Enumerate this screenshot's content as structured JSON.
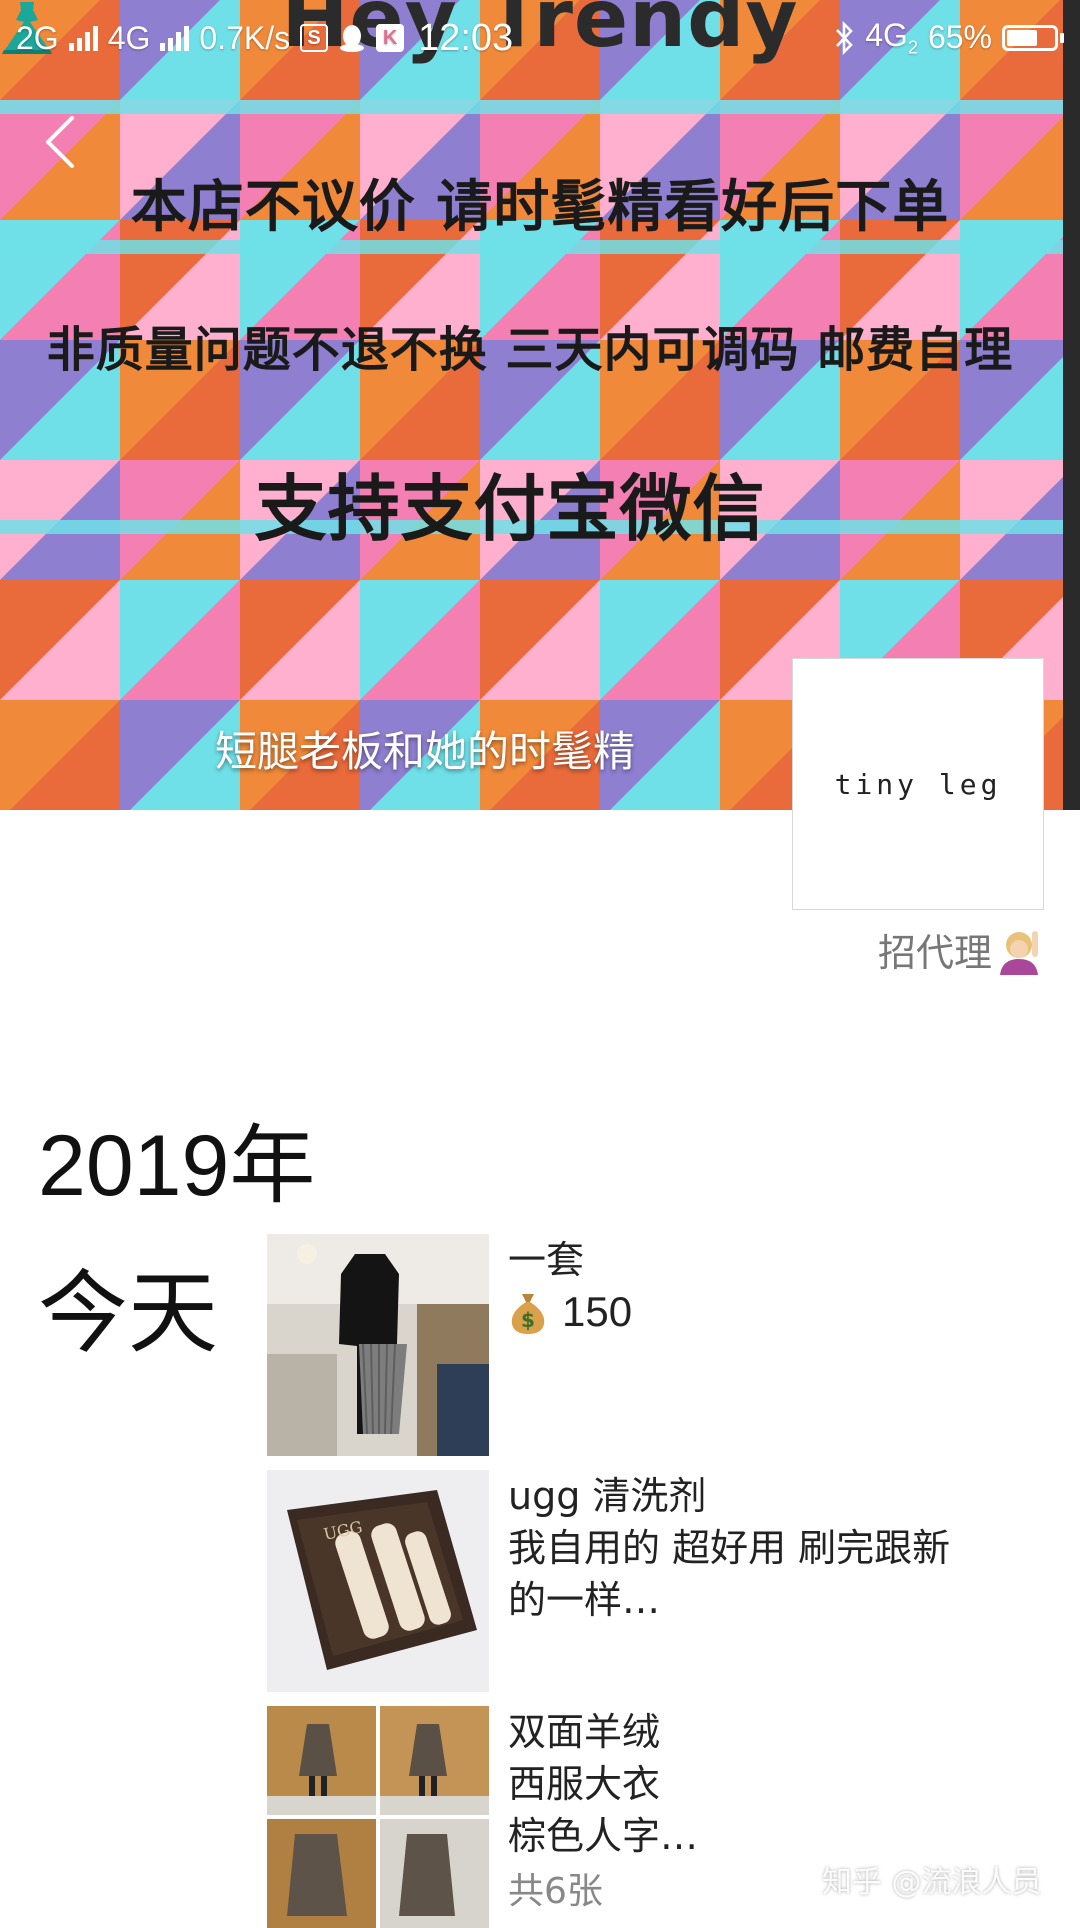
{
  "status_bar": {
    "network_1": "2G",
    "network_2": "4G",
    "speed": "0.7K/s",
    "time": "12:03",
    "net_right": "4G",
    "net_right_sub": "2",
    "battery": "65%",
    "battery_level": 0.65
  },
  "cover": {
    "title": "Hey Trendy",
    "line1": "本店不议价 请时髦精看好后下单",
    "line2": "非质量问题不退不换 三天内可调码 邮费自理",
    "line3": "支持支付宝微信",
    "caption": "短腿老板和她的时髦精"
  },
  "profile": {
    "avatar_text": "tiny leg",
    "agent_link": "招代理"
  },
  "timeline": {
    "year": "2019",
    "year_suffix": "年",
    "day": "今天",
    "posts": [
      {
        "lines": [
          "一套"
        ],
        "price": "150"
      },
      {
        "lines": [
          "ugg 清洗剂",
          "我自用的 超好用 刷完跟新",
          "的一样…"
        ]
      },
      {
        "lines": [
          "双面羊绒",
          "西服大衣",
          "棕色人字…"
        ],
        "photo_count": "共6张"
      }
    ]
  },
  "watermark": "知乎 @流浪人员",
  "colors": {
    "cover_orange": "#f08a3a",
    "cover_pink": "#f47fb2",
    "cover_cyan": "#6fe0e8",
    "cover_purple": "#8e7fd0"
  }
}
